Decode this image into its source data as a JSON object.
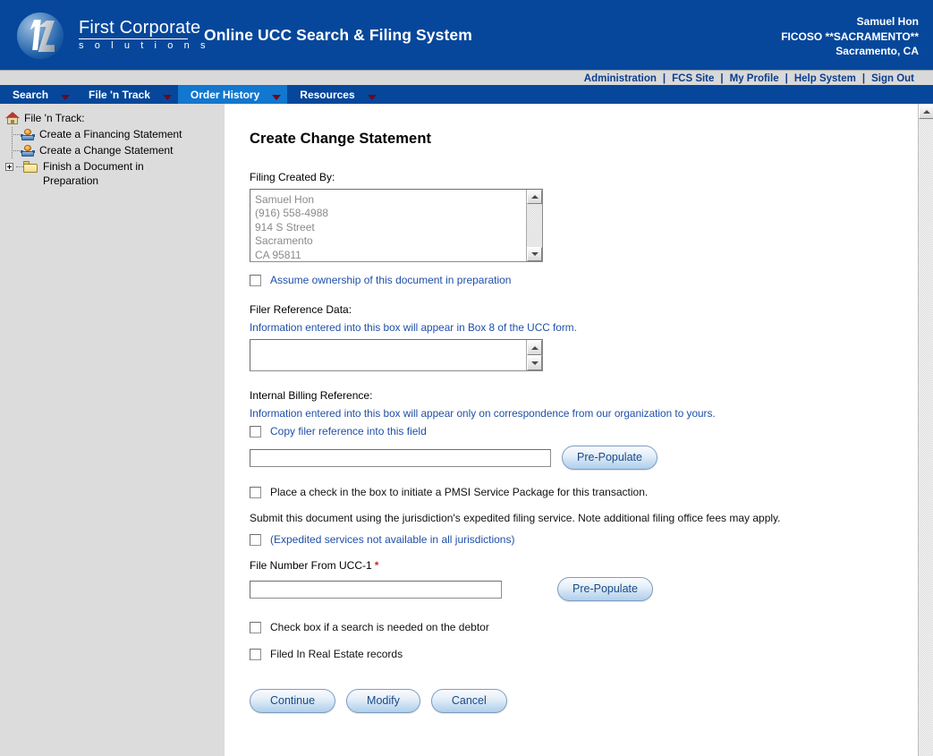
{
  "brand": {
    "logo_line1": "First Corporate",
    "logo_line2": "s o l u t i o n s",
    "logo_icon": "fcs-sphere-logo",
    "app_title": "Online UCC Search & Filing System",
    "banner_color": "#06479B",
    "accent_color": "#1277CF",
    "link_color": "#1F4FA8"
  },
  "user": {
    "name": "Samuel Hon",
    "account": "FICOSO **SACRAMENTO**",
    "location": "Sacramento, CA"
  },
  "utility_nav": {
    "items": [
      {
        "label": "Administration"
      },
      {
        "label": "FCS Site"
      },
      {
        "label": "My Profile"
      },
      {
        "label": "Help System"
      },
      {
        "label": "Sign Out"
      }
    ],
    "separator": "|"
  },
  "tabs": [
    {
      "label": "Search",
      "active": false
    },
    {
      "label": "File 'n Track",
      "active": false
    },
    {
      "label": "Order History",
      "active": true
    },
    {
      "label": "Resources",
      "active": false
    }
  ],
  "sidebar": {
    "root": {
      "label": "File 'n Track:",
      "icon": "house-icon"
    },
    "items": [
      {
        "label": "Create a Financing Statement",
        "icon": "node-icon"
      },
      {
        "label": "Create a Change Statement",
        "icon": "node-icon"
      },
      {
        "label": "Finish a Document in Preparation",
        "icon": "folder-icon",
        "expander": "plus-box-icon"
      }
    ]
  },
  "form": {
    "title": "Create Change Statement",
    "created_by": {
      "label": "Filing Created By:",
      "value": "Samuel Hon\n(916) 558-4988\n914 S Street\nSacramento\nCA 95811"
    },
    "assume_ownership": {
      "label": "Assume ownership of this document in preparation",
      "checked": false
    },
    "filer_reference": {
      "label": "Filer Reference Data:",
      "hint": "Information entered into this box will appear in Box 8 of the UCC form.",
      "value": ""
    },
    "internal_billing": {
      "label": "Internal Billing Reference:",
      "hint": "Information entered into this box will appear only on correspondence from our organization to yours.",
      "copy_checkbox_label": "Copy filer reference into this field",
      "copy_checked": false,
      "value": "",
      "prepopulate_label": "Pre-Populate"
    },
    "pmsi": {
      "label": "Place a check in the box to initiate a PMSI Service Package for this transaction.",
      "checked": false
    },
    "expedited": {
      "paragraph": "Submit this document using the jurisdiction's expedited filing service. Note additional filing office fees may apply.",
      "label": "(Expedited services not available in all jurisdictions)",
      "checked": false
    },
    "file_number": {
      "label": "File Number From UCC-1",
      "required_marker": "*",
      "value": "",
      "prepopulate_label": "Pre-Populate"
    },
    "search_debtor": {
      "label": "Check box if a search is needed on the debtor",
      "checked": false
    },
    "real_estate": {
      "label": "Filed In Real Estate records",
      "checked": false
    },
    "actions": {
      "continue_label": "Continue",
      "modify_label": "Modify",
      "cancel_label": "Cancel"
    }
  }
}
